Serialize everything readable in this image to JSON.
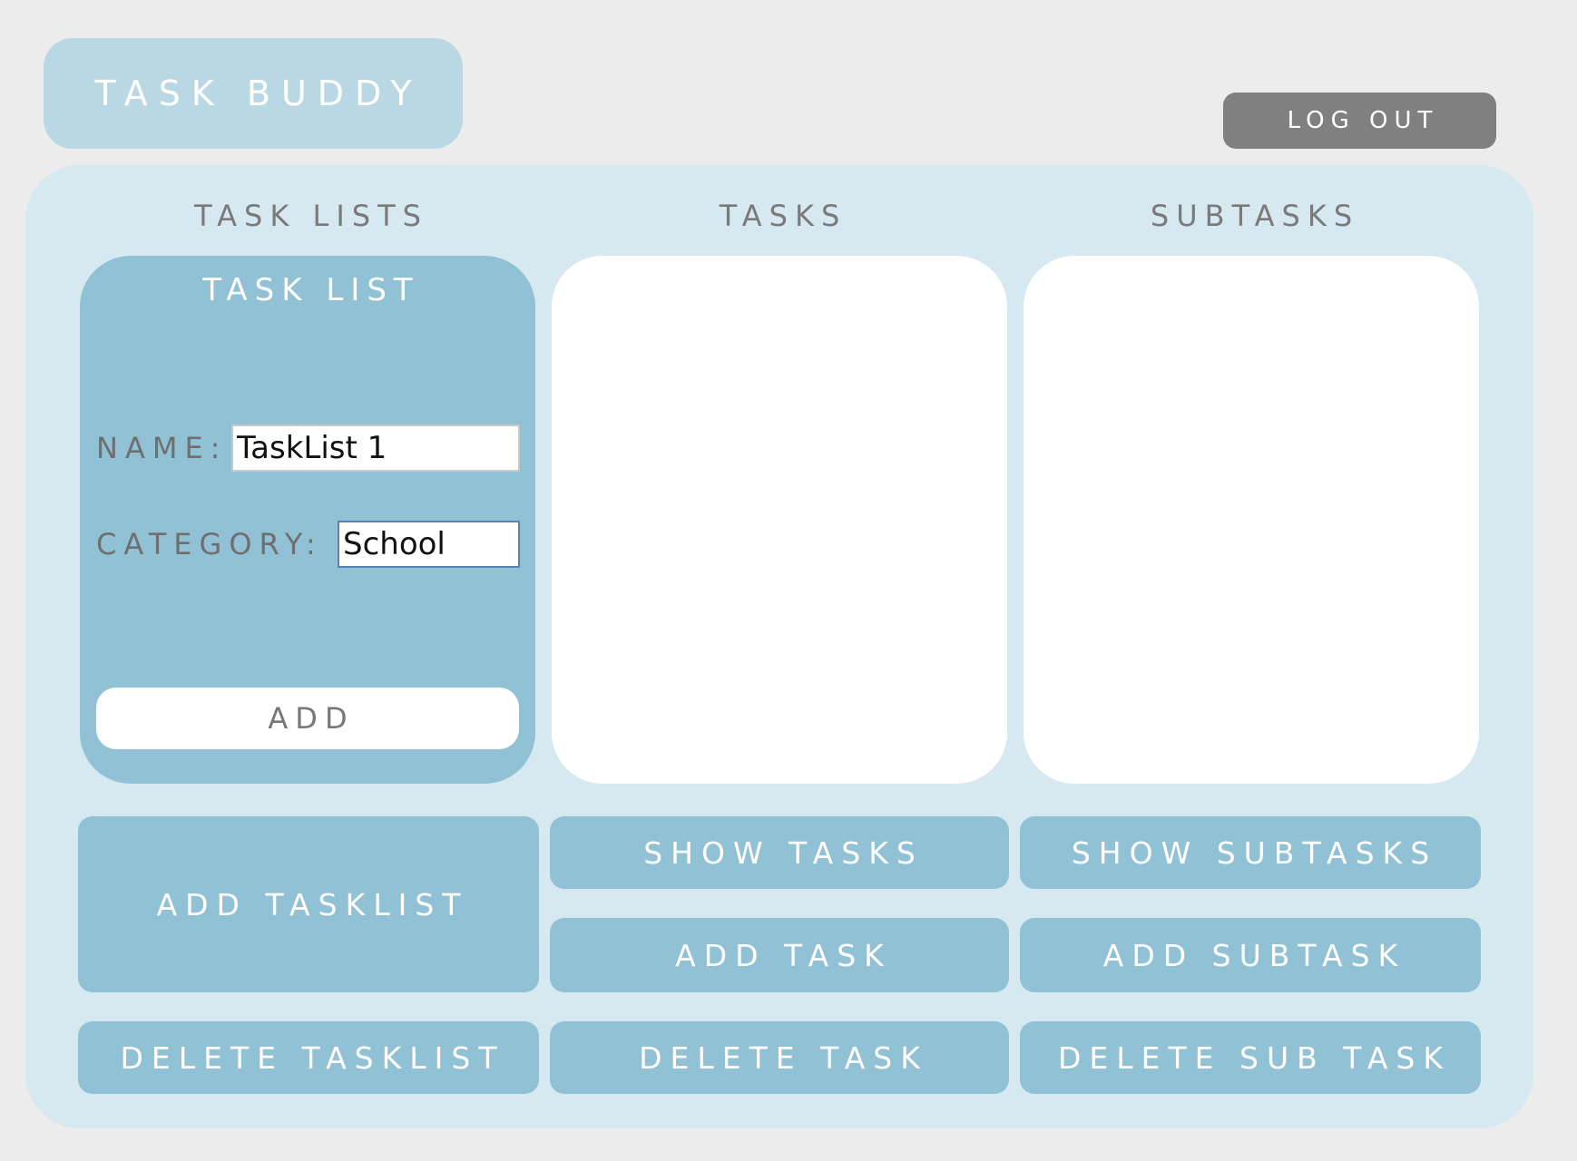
{
  "app": {
    "title": "TASK BUDDY",
    "logout_label": "LOG OUT"
  },
  "columns": {
    "task_lists": "TASK LISTS",
    "tasks": "TASKS",
    "subtasks": "SUBTASKS"
  },
  "task_list_form": {
    "title": "TASK LIST",
    "name_label": "NAME:",
    "name_value": "TaskList 1",
    "category_label": "CATEGORY:",
    "category_value": "School",
    "add_label": "ADD"
  },
  "actions": {
    "add_tasklist": "ADD TASKLIST",
    "show_tasks": "SHOW TASKS",
    "show_subtasks": "SHOW SUBTASKS",
    "add_task": "ADD TASK",
    "add_subtask": "ADD SUBTASK",
    "delete_tasklist": "DELETE TASKLIST",
    "delete_task": "DELETE TASK",
    "delete_subtask": "DELETE SUB TASK"
  },
  "colors": {
    "page_bg": "#ececec",
    "panel_bg": "#d6e8f0",
    "accent": "#91c1d4",
    "brand_bg": "#b9d8e3",
    "logout_bg": "#808080"
  }
}
